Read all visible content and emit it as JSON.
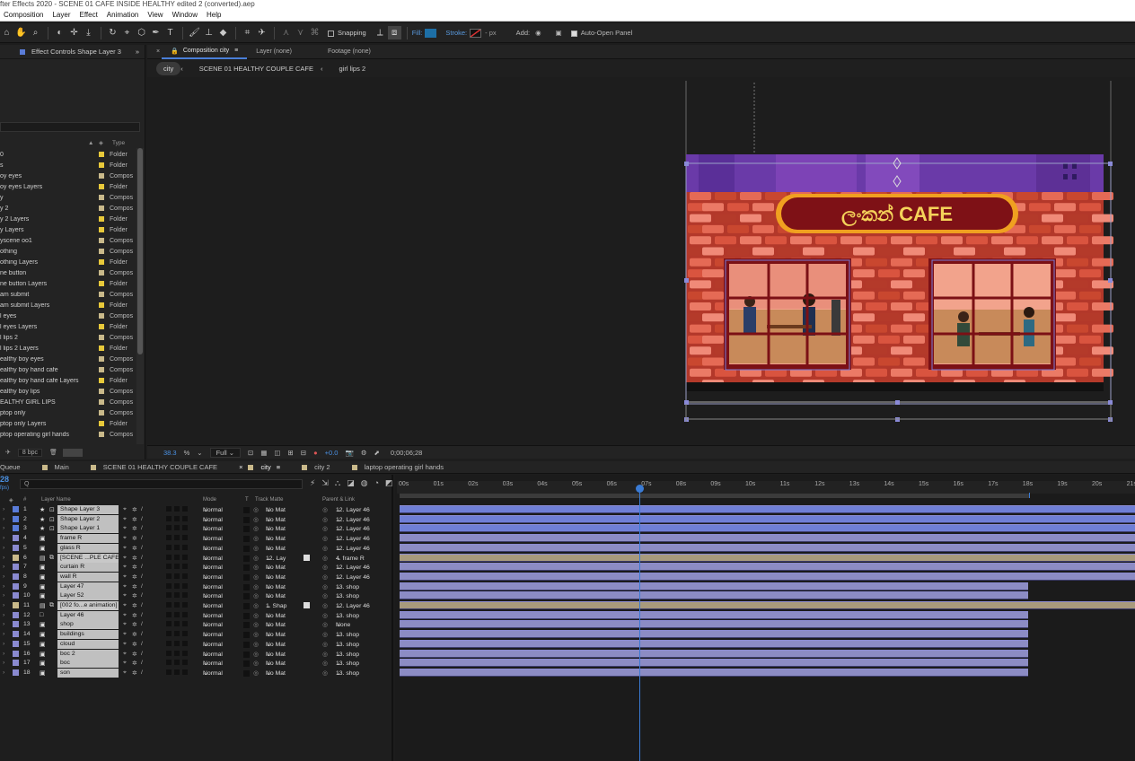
{
  "app": {
    "title_fragment": "fter Effects 2020 - SCENE 01 CAFE INSIDE HEALTHY edited 2 (converted).aep",
    "menu": [
      "Composition",
      "Layer",
      "Effect",
      "Animation",
      "View",
      "Window",
      "Help"
    ]
  },
  "toolbar": {
    "snapping_label": "Snapping",
    "fill_label": "Fill:",
    "stroke_label": "Stroke:",
    "stroke_px": "- px",
    "add_label": "Add:",
    "auto_open_label": "Auto-Open Panel",
    "fill_color": "#1d6fa6",
    "stroke_color": "#c0392b"
  },
  "effect_controls": {
    "tab_label": "Effect Controls Shape Layer 3"
  },
  "project": {
    "type_header": "Type",
    "items": [
      {
        "name": "0",
        "type": "Folder",
        "color": "#e8c93a"
      },
      {
        "name": "s",
        "type": "Folder",
        "color": "#e8c93a"
      },
      {
        "name": "oy eyes",
        "type": "Compos",
        "color": "#c9b98a"
      },
      {
        "name": "oy eyes Layers",
        "type": "Folder",
        "color": "#e8c93a"
      },
      {
        "name": "y",
        "type": "Compos",
        "color": "#c9b98a"
      },
      {
        "name": "y 2",
        "type": "Compos",
        "color": "#c9b98a"
      },
      {
        "name": "y 2 Layers",
        "type": "Folder",
        "color": "#e8c93a"
      },
      {
        "name": "y Layers",
        "type": "Folder",
        "color": "#e8c93a"
      },
      {
        "name": "yscene oo1",
        "type": "Compos",
        "color": "#c9b98a"
      },
      {
        "name": "othing",
        "type": "Compos",
        "color": "#c9b98a"
      },
      {
        "name": "othing Layers",
        "type": "Folder",
        "color": "#e8c93a"
      },
      {
        "name": "ne button",
        "type": "Compos",
        "color": "#c9b98a"
      },
      {
        "name": "ne button Layers",
        "type": "Folder",
        "color": "#e8c93a"
      },
      {
        "name": "am submit",
        "type": "Compos",
        "color": "#c9b98a"
      },
      {
        "name": "am submit Layers",
        "type": "Folder",
        "color": "#e8c93a"
      },
      {
        "name": "l eyes",
        "type": "Compos",
        "color": "#c9b98a"
      },
      {
        "name": "l eyes Layers",
        "type": "Folder",
        "color": "#e8c93a"
      },
      {
        "name": "l lips 2",
        "type": "Compos",
        "color": "#c9b98a"
      },
      {
        "name": "l lips 2 Layers",
        "type": "Folder",
        "color": "#e8c93a"
      },
      {
        "name": "ealthy boy eyes",
        "type": "Compos",
        "color": "#c9b98a"
      },
      {
        "name": "ealthy boy hand cafe",
        "type": "Compos",
        "color": "#c9b98a"
      },
      {
        "name": "ealthy boy hand cafe Layers",
        "type": "Folder",
        "color": "#e8c93a"
      },
      {
        "name": "ealthy boy lips",
        "type": "Compos",
        "color": "#c9b98a"
      },
      {
        "name": "EALTHY GIRL LIPS",
        "type": "Compos",
        "color": "#c9b98a"
      },
      {
        "name": "ptop only",
        "type": "Compos",
        "color": "#c9b98a"
      },
      {
        "name": "ptop only Layers",
        "type": "Folder",
        "color": "#e8c93a"
      },
      {
        "name": "ptop operating girl hands",
        "type": "Compos",
        "color": "#c9b98a"
      }
    ],
    "bpc": "8 bpc"
  },
  "composition": {
    "tab_label": "Composition city",
    "layer_tab": "Layer (none)",
    "footage_tab": "Footage (none)",
    "breadcrumbs": [
      "city",
      "SCENE 01 HEALTHY COUPLE CAFE",
      "girl lips 2"
    ],
    "sign_text": "ලංකන් CAFE",
    "zoom": "38.3",
    "zoom_unit": "%",
    "resolution": "Full",
    "exposure": "+0.0",
    "timecode": "0;00;06;28"
  },
  "timeline": {
    "tabs": [
      {
        "label": "Queue",
        "color": ""
      },
      {
        "label": "Main",
        "color": "#c9b98a"
      },
      {
        "label": "SCENE 01 HEALTHY COUPLE CAFE",
        "color": "#c9b98a"
      },
      {
        "label": "city",
        "color": "#c9b98a"
      },
      {
        "label": "city 2",
        "color": "#c9b98a"
      },
      {
        "label": "laptop operating girl hands",
        "color": "#c9b98a"
      }
    ],
    "time_readout": "28",
    "fps_fragment": "fps)",
    "search_placeholder": "Q",
    "headers": {
      "num": "#",
      "layer_name": "Layer Name",
      "mode": "Mode",
      "t": "T",
      "track_matte": "Track Matte",
      "parent": "Parent & Link"
    },
    "ruler": [
      "00s",
      "01s",
      "02s",
      "03s",
      "04s",
      "05s",
      "06s",
      "07s",
      "08s",
      "09s",
      "10s",
      "11s",
      "12s",
      "13s",
      "14s",
      "15s",
      "16s",
      "17s",
      "18s",
      "19s",
      "20s",
      "21s"
    ],
    "layers": [
      {
        "num": "1",
        "name": "Shape Layer 3",
        "mode": "Normal",
        "matte": "No Mat",
        "parent": "12. Layer 46",
        "label": "#5a7cd8",
        "kind": "shape",
        "bar": "#6f7fd6",
        "end": 1
      },
      {
        "num": "2",
        "name": "Shape Layer 2",
        "mode": "Normal",
        "matte": "No Mat",
        "parent": "12. Layer 46",
        "label": "#5a7cd8",
        "kind": "shape",
        "bar": "#6f7fd6",
        "end": 1
      },
      {
        "num": "3",
        "name": "Shape Layer 1",
        "mode": "Normal",
        "matte": "No Mat",
        "parent": "12. Layer 46",
        "label": "#5a7cd8",
        "kind": "shape",
        "bar": "#6f7fd6",
        "end": 1
      },
      {
        "num": "4",
        "name": "frame R",
        "mode": "Normal",
        "matte": "No Mat",
        "parent": "12. Layer 46",
        "label": "#8a8ad0",
        "kind": "ps",
        "bar": "#8c8cc4",
        "end": 1
      },
      {
        "num": "5",
        "name": "glass R",
        "mode": "Normal",
        "matte": "No Mat",
        "parent": "12. Layer 46",
        "label": "#8a8ad0",
        "kind": "ps",
        "bar": "#8c8cc4",
        "end": 1
      },
      {
        "num": "6",
        "name": "[SCENE ...PLE CAFE]",
        "mode": "Normal",
        "matte": "12. Lay",
        "parent": "4. frame R",
        "label": "#c9b98a",
        "kind": "comp",
        "bar": "#a89a7c",
        "end": 1
      },
      {
        "num": "7",
        "name": "curtain R",
        "mode": "Normal",
        "matte": "No Mat",
        "parent": "12. Layer 46",
        "label": "#8a8ad0",
        "kind": "ps",
        "bar": "#8c8cc4",
        "end": 1
      },
      {
        "num": "8",
        "name": "wall R",
        "mode": "Normal",
        "matte": "No Mat",
        "parent": "12. Layer 46",
        "label": "#8a8ad0",
        "kind": "ps",
        "bar": "#8c8cc4",
        "end": 1
      },
      {
        "num": "9",
        "name": "Layer 47",
        "mode": "Normal",
        "matte": "No Mat",
        "parent": "13. shop",
        "label": "#8a8ad0",
        "kind": "ps",
        "bar": "#8c8cc4",
        "end": 0.855
      },
      {
        "num": "10",
        "name": "Layer 52",
        "mode": "Normal",
        "matte": "No Mat",
        "parent": "13. shop",
        "label": "#8a8ad0",
        "kind": "ps",
        "bar": "#8c8cc4",
        "end": 0.855
      },
      {
        "num": "11",
        "name": "[002 fo...e animation]",
        "mode": "Normal",
        "matte": "1. Shap",
        "parent": "12. Layer 46",
        "label": "#c9b98a",
        "kind": "comp",
        "bar": "#a89a7c",
        "end": 1
      },
      {
        "num": "12",
        "name": "Layer 46",
        "mode": "Normal",
        "matte": "No Mat",
        "parent": "13. shop",
        "label": "#8a8ad0",
        "kind": "null",
        "bar": "#8c8cc4",
        "end": 0.855
      },
      {
        "num": "13",
        "name": "shop",
        "mode": "Normal",
        "matte": "No Mat",
        "parent": "None",
        "label": "#8a8ad0",
        "kind": "ps",
        "bar": "#8c8cc4",
        "end": 0.855
      },
      {
        "num": "14",
        "name": "buildings",
        "mode": "Normal",
        "matte": "No Mat",
        "parent": "13. shop",
        "label": "#8a8ad0",
        "kind": "ps",
        "bar": "#8c8cc4",
        "end": 0.855
      },
      {
        "num": "15",
        "name": "cloud",
        "mode": "Normal",
        "matte": "No Mat",
        "parent": "13. shop",
        "label": "#8a8ad0",
        "kind": "ps",
        "bar": "#8c8cc4",
        "end": 0.855
      },
      {
        "num": "16",
        "name": "boc 2",
        "mode": "Normal",
        "matte": "No Mat",
        "parent": "13. shop",
        "label": "#8a8ad0",
        "kind": "ps",
        "bar": "#8c8cc4",
        "end": 0.855
      },
      {
        "num": "17",
        "name": "boc",
        "mode": "Normal",
        "matte": "No Mat",
        "parent": "13. shop",
        "label": "#8a8ad0",
        "kind": "ps",
        "bar": "#8c8cc4",
        "end": 0.855
      },
      {
        "num": "18",
        "name": "son",
        "mode": "Normal",
        "matte": "No Mat",
        "parent": "13. shop",
        "label": "#8a8ad0",
        "kind": "ps",
        "bar": "#8c8cc4",
        "end": 0.855
      }
    ]
  }
}
